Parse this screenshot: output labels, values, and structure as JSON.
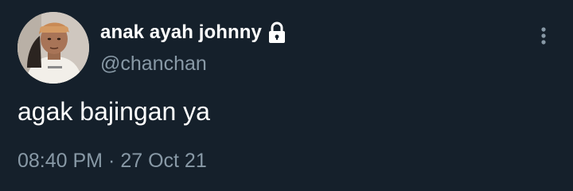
{
  "tweet": {
    "display_name": "anak ayah johnny",
    "handle": "@chanchan",
    "protected_icon": "lock-icon",
    "more_icon": "more-vertical-icon",
    "text": "agak bajingan ya",
    "time": "08:40 PM",
    "separator": "·",
    "date": "27 Oct 21"
  },
  "colors": {
    "background": "#15202b",
    "primary_text": "#ffffff",
    "secondary_text": "#8899a6"
  }
}
